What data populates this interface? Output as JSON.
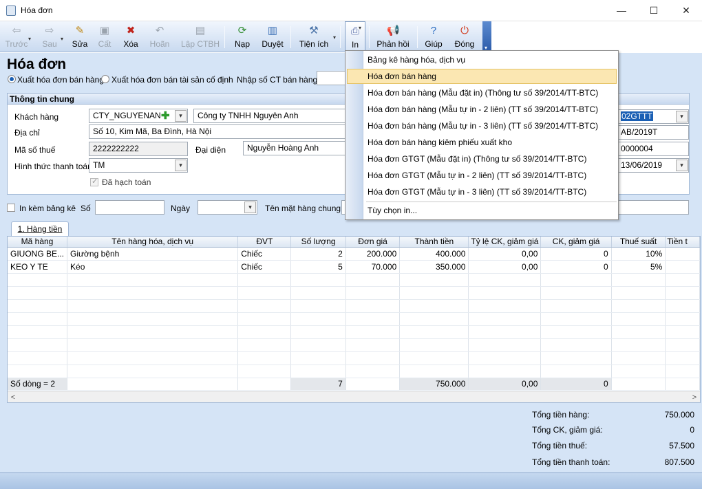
{
  "window": {
    "title": "Hóa đơn",
    "minimize": "—",
    "maximize": "☐",
    "close": "✕"
  },
  "toolbar": {
    "prev": "Trước",
    "next": "Sau",
    "edit": "Sửa",
    "save": "Cất",
    "delete": "Xóa",
    "undo": "Hoãn",
    "create_doc": "Lập CTBH",
    "load": "Nạp",
    "approve": "Duyệt",
    "utilities": "Tiện ích",
    "print": "In",
    "feedback": "Phản hồi",
    "help": "Giúp",
    "close": "Đóng"
  },
  "page": {
    "title": "Hóa đơn",
    "radio_sale": "Xuất hóa đơn bán hàng",
    "radio_asset": "Xuất hóa đơn bán tài sản cố định",
    "import_label": "Nhập số CT bán hàng"
  },
  "general": {
    "header": "Thông tin chung",
    "customer_label": "Khách hàng",
    "customer_code": "CTY_NGUYENANH",
    "customer_name": "Công ty TNHH Nguyên Anh",
    "address_label": "Địa chỉ",
    "address": "Số 10, Kim Mã, Ba Đình, Hà Nội",
    "tax_label": "Mã số thuế",
    "tax_code": "2222222222",
    "rep_label": "Đại diện",
    "rep": "Nguyễn Hoàng Anh",
    "payment_label": "Hình thức thanh toán",
    "payment": "TM",
    "posted_label": "Đã hạch toán",
    "form_no": "02GTTT",
    "serial": "AB/2019T",
    "invoice_no": "0000004",
    "date": "13/06/2019"
  },
  "attach": {
    "label": "In kèm bảng kê",
    "no_label": "Số",
    "date_label": "Ngày",
    "item_label": "Tên mặt hàng chung"
  },
  "tab": {
    "label": "1. Hàng tiền"
  },
  "grid": {
    "columns": [
      "Mã hàng",
      "Tên hàng hóa, dịch vụ",
      "ĐVT",
      "Số lượng",
      "Đơn giá",
      "Thành tiền",
      "Tỷ lệ CK, giảm giá",
      "CK, giảm giá",
      "Thuế suất",
      "Tiền t"
    ],
    "rows": [
      [
        "GIUONG BE...",
        "Giường bệnh",
        "Chiếc",
        "2",
        "200.000",
        "400.000",
        "0,00",
        "0",
        "10%",
        ""
      ],
      [
        "KEO Y TE",
        "Kéo",
        "Chiếc",
        "5",
        "70.000",
        "350.000",
        "0,00",
        "0",
        "5%",
        ""
      ]
    ],
    "footer": [
      "Số dòng = 2",
      "",
      "",
      "7",
      "",
      "750.000",
      "0,00",
      "0",
      "",
      ""
    ]
  },
  "totals": {
    "goods_label": "Tổng tiền hàng:",
    "goods": "750.000",
    "discount_label": "Tổng CK, giảm giá:",
    "discount": "0",
    "tax_label": "Tổng tiền thuế:",
    "tax": "57.500",
    "pay_label": "Tổng tiền thanh toán:",
    "pay": "807.500"
  },
  "print_menu": {
    "items": [
      "Bảng kê hàng hóa, dịch vụ",
      "Hóa đơn bán hàng",
      "Hóa đơn bán hàng (Mẫu đặt in) (Thông tư số 39/2014/TT-BTC)",
      "Hóa đơn bán hàng (Mẫu tự in - 2 liên) (TT số 39/2014/TT-BTC)",
      "Hóa đơn bán hàng (Mẫu tự in - 3 liên) (TT số 39/2014/TT-BTC)",
      "Hóa đơn bán hàng kiêm phiếu xuất kho",
      "Hóa đơn GTGT (Mẫu đặt in) (Thông tư số 39/2014/TT-BTC)",
      "Hóa đơn GTGT (Mẫu tự in - 2 liên) (TT số 39/2014/TT-BTC)",
      "Hóa đơn GTGT (Mẫu tự in - 3 liên) (TT số 39/2014/TT-BTC)",
      "Tùy chọn in..."
    ],
    "highlighted": "Hóa đơn bán hàng"
  },
  "colors": {
    "accent": "#d5e4f6",
    "highlight": "#fbe7b2",
    "selection": "#1a5fb4"
  }
}
